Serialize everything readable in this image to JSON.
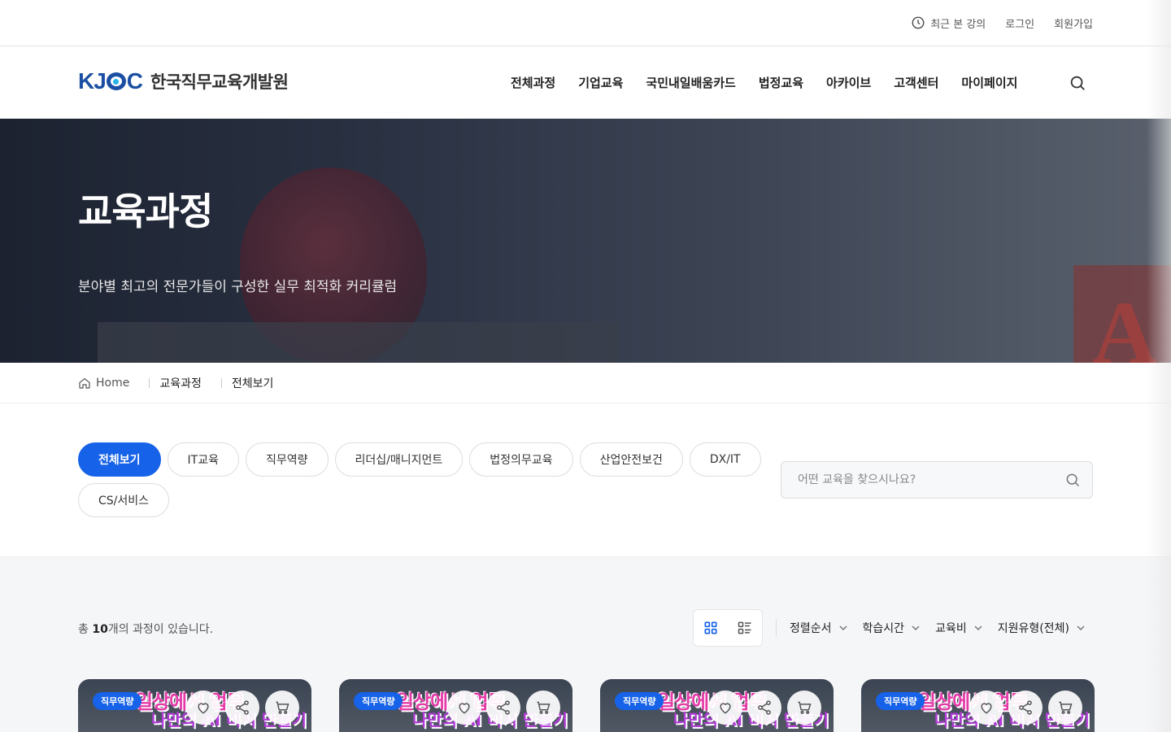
{
  "util_bar": {
    "recent_label": "최근 본 강의",
    "login_label": "로그인",
    "signup_label": "회원가입"
  },
  "header": {
    "logo_mark": "KJOC",
    "logo_text": "한국직무교육개발원",
    "nav": [
      "전체과정",
      "기업교육",
      "국민내일배움카드",
      "법정교육",
      "아카이브",
      "고객센터",
      "마이페이지"
    ]
  },
  "hero": {
    "title": "교육과정",
    "subtitle": "분야별 최고의 전문가들이 구성한 실무 최적화 커리큘럼"
  },
  "breadcrumb": {
    "home": "Home",
    "level1": "교육과정",
    "level2": "전체보기"
  },
  "filter": {
    "chips": [
      "전체보기",
      "IT교육",
      "직무역량",
      "리더십/매니지먼트",
      "법정의무교육",
      "산업안전보건",
      "DX/IT",
      "CS/서비스"
    ],
    "active_index": 0,
    "search_placeholder": "어떤 교육을 찾으시나요?"
  },
  "list": {
    "count_prefix": "총 ",
    "count_value": "10",
    "count_suffix": "개의 과정이 있습니다.",
    "sorts": [
      "정렬순서",
      "학습시간",
      "교육비",
      "지원유형(전체)"
    ]
  },
  "cards": [
    {
      "tag": "직무역량",
      "thumb_line1": "일상에서 업무",
      "thumb_line2": "나만의 AI 비서 만들기"
    },
    {
      "tag": "직무역량",
      "thumb_line1": "일상에서 업무",
      "thumb_line2": "나만의 AI 비서 만들기"
    },
    {
      "tag": "직무역량",
      "thumb_line1": "일상에서 업무",
      "thumb_line2": "나만의 AI 비서 만들기"
    },
    {
      "tag": "직무역량",
      "thumb_line1": "일상에서 업무",
      "thumb_line2": "나만의 AI 비서 만들기"
    }
  ],
  "colors": {
    "primary": "#1662e8",
    "logo_blue": "#1b4fa3",
    "list_bg": "#f5f6f8"
  }
}
